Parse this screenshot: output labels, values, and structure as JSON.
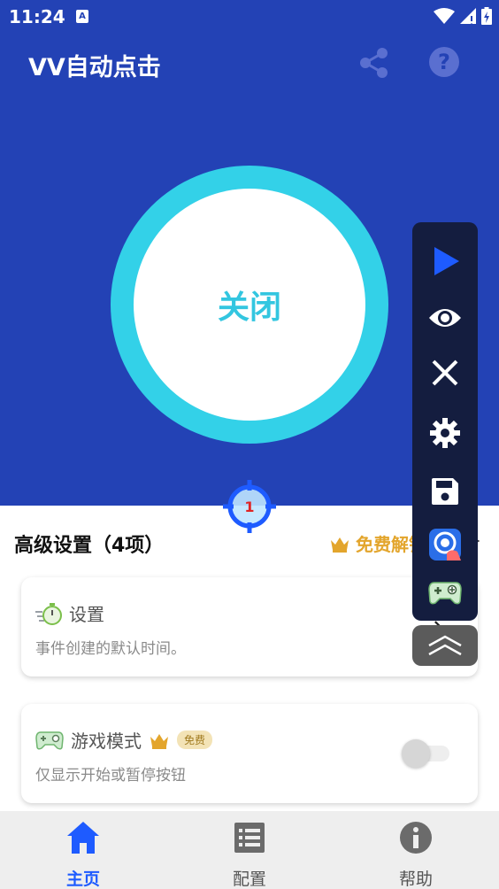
{
  "status_bar": {
    "time": "11:24",
    "notification_letter": "A"
  },
  "header": {
    "title": "VV自动点击",
    "share_icon": "share-icon",
    "help_icon": "help-icon"
  },
  "main_toggle": {
    "label": "关闭"
  },
  "target": {
    "number": "1"
  },
  "advanced": {
    "title": "高级设置（4项）",
    "unlock_label": "免费解锁",
    "chevron": ">"
  },
  "cards": [
    {
      "title": "设置",
      "subtitle": "事件创建的默认时间。",
      "icon": "stopwatch-icon"
    },
    {
      "title": "游戏模式",
      "badge": "免费",
      "subtitle": "仅显示开始或暂停按钮",
      "icon": "gamepad-icon",
      "toggle_on": false
    }
  ],
  "floating_panel": {
    "buttons": [
      "play-icon",
      "eye-icon",
      "close-icon",
      "gear-icon",
      "save-icon",
      "app-icon",
      "gamepad-icon"
    ],
    "collapse_icon": "double-chevron-up-icon"
  },
  "bottom_nav": [
    {
      "label": "主页",
      "icon": "home-icon",
      "active": true
    },
    {
      "label": "配置",
      "icon": "list-icon",
      "active": false
    },
    {
      "label": "帮助",
      "icon": "info-icon",
      "active": false
    }
  ],
  "colors": {
    "header_bg": "#2342b5",
    "ring": "#33d1e8",
    "accent_blue": "#1e5bff",
    "gold": "#e3a52c",
    "panel_bg": "#141d3f"
  }
}
